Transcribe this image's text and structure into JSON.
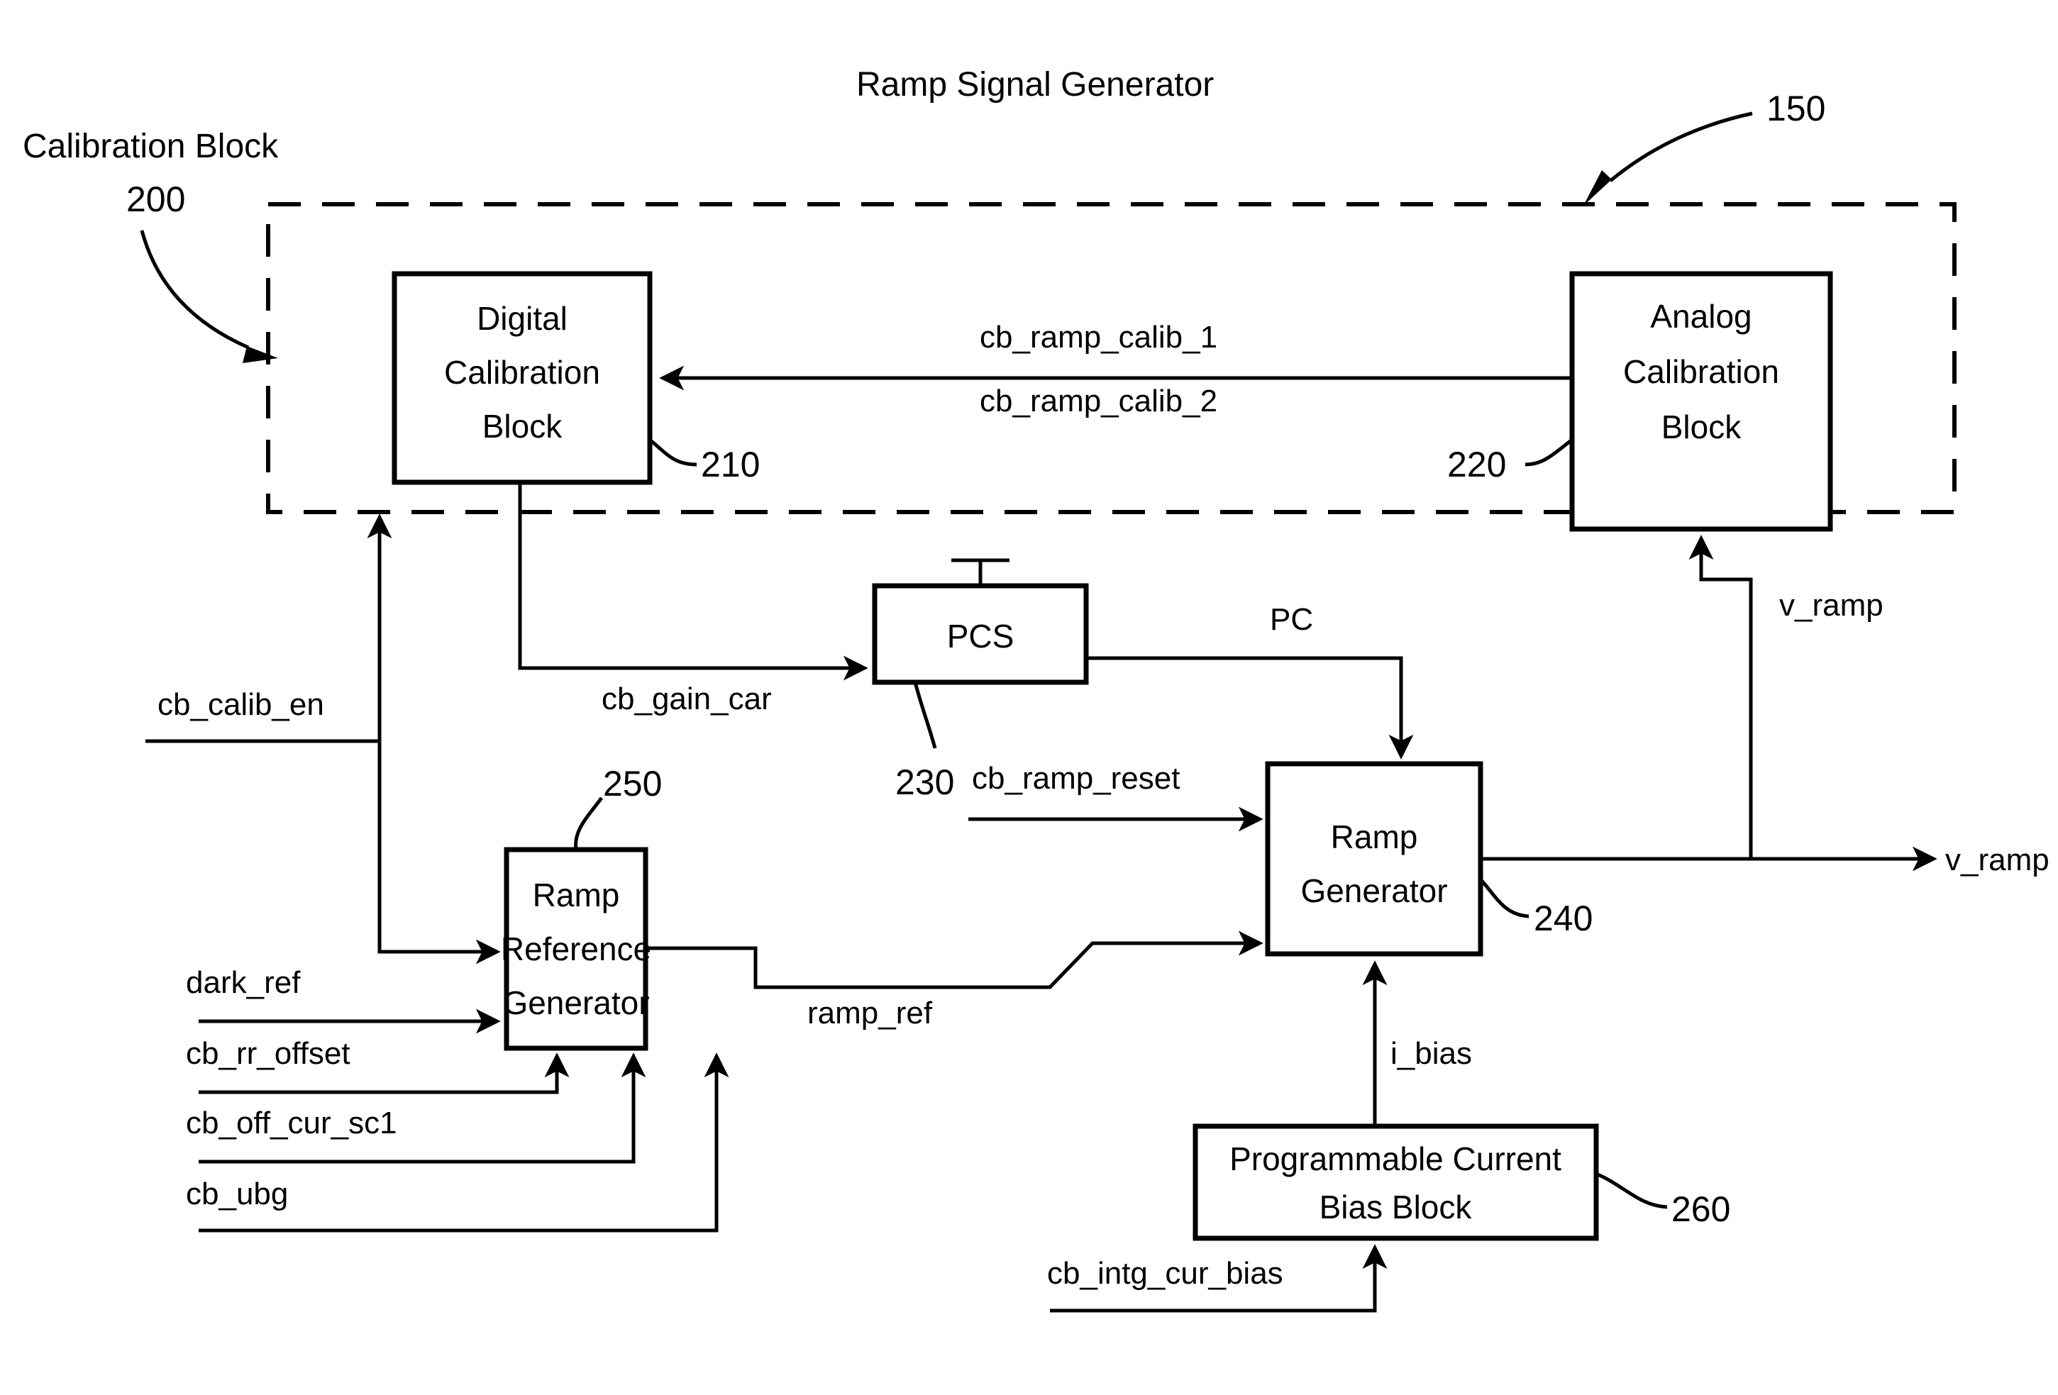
{
  "figure": {
    "title": "Ramp Signal Generator",
    "outer_ref": "150",
    "region_label": "Calibration Block",
    "region_ref": "200"
  },
  "blocks": {
    "digital_calibration": {
      "line1": "Digital",
      "line2": "Calibration",
      "line3": "Block",
      "ref": "210"
    },
    "analog_calibration": {
      "line1": "Analog",
      "line2": "Calibration",
      "line3": "Block",
      "ref": "220"
    },
    "pcs": {
      "label": "PCS",
      "ref": "230"
    },
    "ramp_generator": {
      "line1": "Ramp",
      "line2": "Generator",
      "ref": "240"
    },
    "ramp_reference_generator": {
      "line1": "Ramp",
      "line2": "Reference",
      "line3": "Generator",
      "ref": "250"
    },
    "programmable_current_bias": {
      "line1": "Programmable Current",
      "line2": "Bias Block",
      "ref": "260"
    }
  },
  "signals": {
    "cb_ramp_calib_1": "cb_ramp_calib_1",
    "cb_ramp_calib_2": "cb_ramp_calib_2",
    "cb_gain_car": "cb_gain_car",
    "cb_calib_en": "cb_calib_en",
    "pc": "PC",
    "cb_ramp_reset": "cb_ramp_reset",
    "ramp_ref": "ramp_ref",
    "dark_ref": "dark_ref",
    "cb_rr_offset": "cb_rr_offset",
    "cb_off_cur_sc1": "cb_off_cur_sc1",
    "cb_ubg": "cb_ubg",
    "i_bias": "i_bias",
    "cb_intg_cur_bias": "cb_intg_cur_bias",
    "v_ramp_feedback": "v_ramp",
    "v_ramp_output": "v_ramp"
  },
  "colors": {
    "stroke": "#000000",
    "background": "#ffffff"
  }
}
